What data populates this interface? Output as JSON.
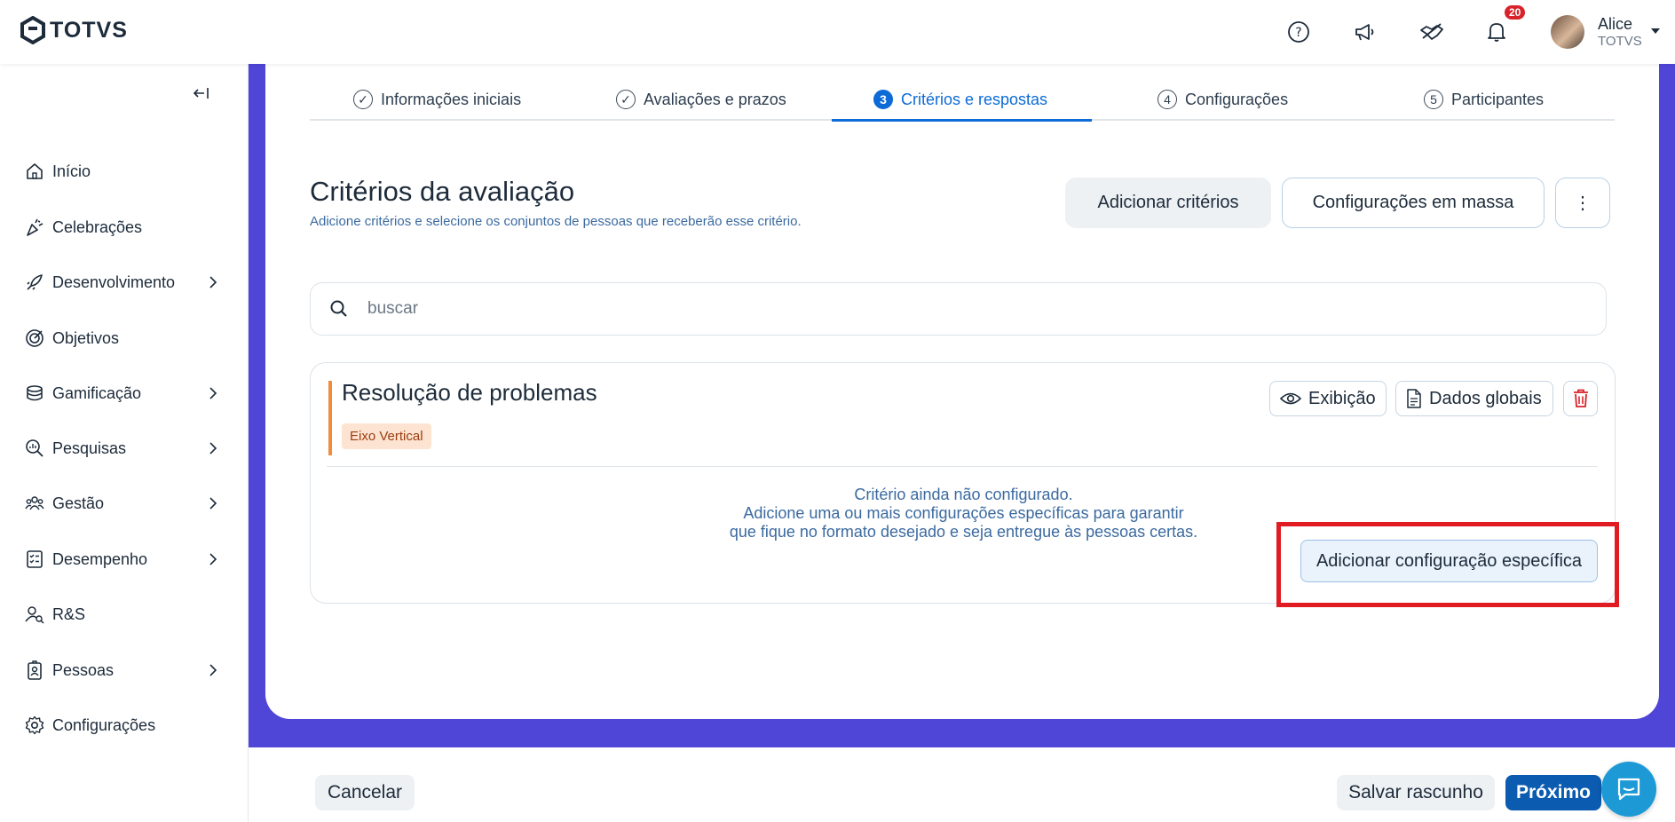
{
  "header": {
    "logo_text": "TOTVS",
    "notification_count": "20",
    "user_name": "Alice",
    "user_org": "TOTVS",
    "icons": [
      "help-icon",
      "megaphone-icon",
      "handshake-icon",
      "bell-icon"
    ]
  },
  "sidebar": {
    "items": [
      {
        "label": "Início",
        "icon": "home-icon",
        "has_submenu": false
      },
      {
        "label": "Celebrações",
        "icon": "celebration-icon",
        "has_submenu": false
      },
      {
        "label": "Desenvolvimento",
        "icon": "rocket-icon",
        "has_submenu": true
      },
      {
        "label": "Objetivos",
        "icon": "target-icon",
        "has_submenu": false
      },
      {
        "label": "Gamificação",
        "icon": "coins-icon",
        "has_submenu": true
      },
      {
        "label": "Pesquisas",
        "icon": "search-chart-icon",
        "has_submenu": true
      },
      {
        "label": "Gestão",
        "icon": "people-icon",
        "has_submenu": true
      },
      {
        "label": "Desempenho",
        "icon": "checklist-icon",
        "has_submenu": true
      },
      {
        "label": "R&S",
        "icon": "user-search-icon",
        "has_submenu": false
      },
      {
        "label": "Pessoas",
        "icon": "badge-icon",
        "has_submenu": true
      },
      {
        "label": "Configurações",
        "icon": "gear-icon",
        "has_submenu": false
      }
    ]
  },
  "stepper": {
    "steps": [
      {
        "label": "Informações iniciais",
        "marker": "✓",
        "state": "done"
      },
      {
        "label": "Avaliações e prazos",
        "marker": "✓",
        "state": "done"
      },
      {
        "label": "Critérios e respostas",
        "marker": "3",
        "state": "active"
      },
      {
        "label": "Configurações",
        "marker": "4",
        "state": "pending"
      },
      {
        "label": "Participantes",
        "marker": "5",
        "state": "pending"
      }
    ]
  },
  "section": {
    "title": "Critérios da avaliação",
    "subtitle": "Adicione critérios e selecione os conjuntos de pessoas que receberão esse critério.",
    "add_label": "Adicionar critérios",
    "mass_label": "Configurações em massa",
    "more_label": "⋮"
  },
  "search": {
    "placeholder": "buscar",
    "value": ""
  },
  "criterion": {
    "title": "Resolução de problemas",
    "tag": "Eixo Vertical",
    "view_label": "Exibição",
    "global_label": "Dados globais",
    "message_lines": [
      "Critério ainda não configurado.",
      "Adicione uma ou mais configurações específicas para garantir",
      "que fique no formato desejado e seja entregue às pessoas certas."
    ],
    "config_label": "Adicionar configuração específica"
  },
  "footer": {
    "cancel_label": "Cancelar",
    "draft_label": "Salvar rascunho",
    "next_label": "Próximo"
  },
  "colors": {
    "accent": "#0c6bd6",
    "purple_band": "#4f46d8",
    "tag_bg": "#fde3d1",
    "tag_bar": "#f28b3c",
    "highlight": "#e11b22",
    "primary_button": "#0b5bb0",
    "chat": "#1d9ad6"
  }
}
